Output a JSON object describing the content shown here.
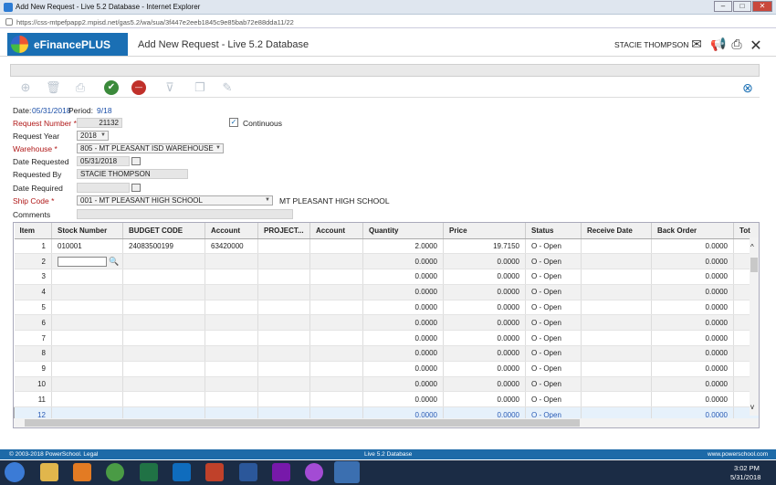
{
  "window": {
    "title": "Add New Request - Live 5.2 Database - Internet Explorer",
    "url": "https://css-mtpefpapp2.mpisd.net/gas5.2/wa/sua/3f447e2eeb1845c9e85bab72e88dda11/22"
  },
  "app": {
    "brand": "eFinancePLUS",
    "page_title": "Add New Request - Live 5.2 Database",
    "user": "STACIE THOMPSON"
  },
  "form": {
    "date_label": "Date:",
    "date_value": "05/31/2018",
    "period_label": "Period:",
    "period_value": "9/18",
    "request_number_label": "Request Number",
    "request_number": "21132",
    "continuous_label": "Continuous",
    "request_year_label": "Request Year",
    "request_year": "2018",
    "warehouse_label": "Warehouse",
    "warehouse": "805 - MT PLEASANT ISD WAREHOUSE",
    "date_requested_label": "Date Requested",
    "date_requested": "05/31/2018",
    "requested_by_label": "Requested By",
    "requested_by": "STACIE THOMPSON",
    "date_required_label": "Date Required",
    "date_required": "",
    "ship_code_label": "Ship Code",
    "ship_code": "001 - MT PLEASANT HIGH SCHOOL",
    "ship_code_desc": "MT PLEASANT HIGH SCHOOL",
    "comments_label": "Comments",
    "comments": ""
  },
  "grid": {
    "columns": [
      "Item",
      "Stock Number",
      "BUDGET CODE",
      "Account",
      "PROJECT...",
      "Account",
      "Quantity",
      "Price",
      "Status",
      "Receive Date",
      "Back Order",
      "Tot"
    ],
    "rows": [
      {
        "item": "1",
        "stock": "010001",
        "budget": "24083500199",
        "account": "63420000",
        "qty": "2.0000",
        "price": "19.7150",
        "status": "O - Open",
        "back": "0.0000"
      },
      {
        "item": "2",
        "stock": "",
        "budget": "",
        "account": "",
        "qty": "0.0000",
        "price": "0.0000",
        "status": "O - Open",
        "back": "0.0000"
      },
      {
        "item": "3",
        "stock": "",
        "budget": "",
        "account": "",
        "qty": "0.0000",
        "price": "0.0000",
        "status": "O - Open",
        "back": "0.0000"
      },
      {
        "item": "4",
        "stock": "",
        "budget": "",
        "account": "",
        "qty": "0.0000",
        "price": "0.0000",
        "status": "O - Open",
        "back": "0.0000"
      },
      {
        "item": "5",
        "stock": "",
        "budget": "",
        "account": "",
        "qty": "0.0000",
        "price": "0.0000",
        "status": "O - Open",
        "back": "0.0000"
      },
      {
        "item": "6",
        "stock": "",
        "budget": "",
        "account": "",
        "qty": "0.0000",
        "price": "0.0000",
        "status": "O - Open",
        "back": "0.0000"
      },
      {
        "item": "7",
        "stock": "",
        "budget": "",
        "account": "",
        "qty": "0.0000",
        "price": "0.0000",
        "status": "O - Open",
        "back": "0.0000"
      },
      {
        "item": "8",
        "stock": "",
        "budget": "",
        "account": "",
        "qty": "0.0000",
        "price": "0.0000",
        "status": "O - Open",
        "back": "0.0000"
      },
      {
        "item": "9",
        "stock": "",
        "budget": "",
        "account": "",
        "qty": "0.0000",
        "price": "0.0000",
        "status": "O - Open",
        "back": "0.0000"
      },
      {
        "item": "10",
        "stock": "",
        "budget": "",
        "account": "",
        "qty": "0.0000",
        "price": "0.0000",
        "status": "O - Open",
        "back": "0.0000"
      },
      {
        "item": "11",
        "stock": "",
        "budget": "",
        "account": "",
        "qty": "0.0000",
        "price": "0.0000",
        "status": "O - Open",
        "back": "0.0000"
      },
      {
        "item": "12",
        "stock": "",
        "budget": "",
        "account": "",
        "qty": "0.0000",
        "price": "0.0000",
        "status": "O - Open",
        "back": "0.0000"
      }
    ]
  },
  "footer": {
    "copyright": "© 2003-2018 PowerSchool. Legal",
    "db": "Live 5.2 Database",
    "site": "www.powerschool.com"
  },
  "taskbar": {
    "time": "3:02 PM",
    "date": "5/31/2018"
  },
  "colors": {
    "brand": "#1a6fb4",
    "required": "#b01818",
    "footer": "#1d6aa8"
  }
}
